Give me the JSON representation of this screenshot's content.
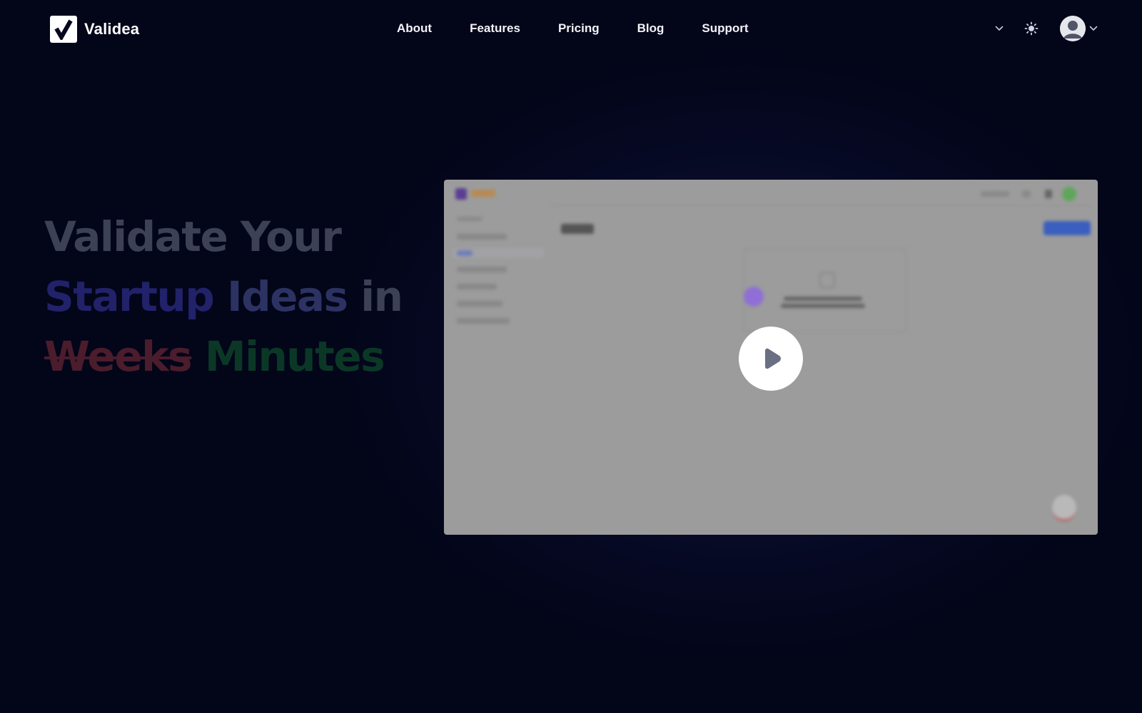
{
  "brand": {
    "name": "Validea"
  },
  "nav": {
    "items": [
      {
        "label": "About"
      },
      {
        "label": "Features"
      },
      {
        "label": "Pricing"
      },
      {
        "label": "Blog"
      },
      {
        "label": "Support"
      }
    ]
  },
  "header_icons": {
    "language": "chevron-down-icon",
    "theme": "sun-icon",
    "user": "user-avatar-icon"
  },
  "hero": {
    "line1": "Validate Your",
    "line2_a": "Startup",
    "line2_b": "Ideas",
    "line2_c": "in",
    "line3_old": "Weeks",
    "line3_new": "Minutes"
  },
  "video": {
    "play_icon": "play-icon"
  },
  "colors": {
    "background": "#030519",
    "glow": "#303482",
    "headline_gray": "#3d4155",
    "headline_blue": "#22226a",
    "headline_struck": "#4a1c2c",
    "headline_green": "#0b3826",
    "video_overlay": "#9c9c9c"
  }
}
